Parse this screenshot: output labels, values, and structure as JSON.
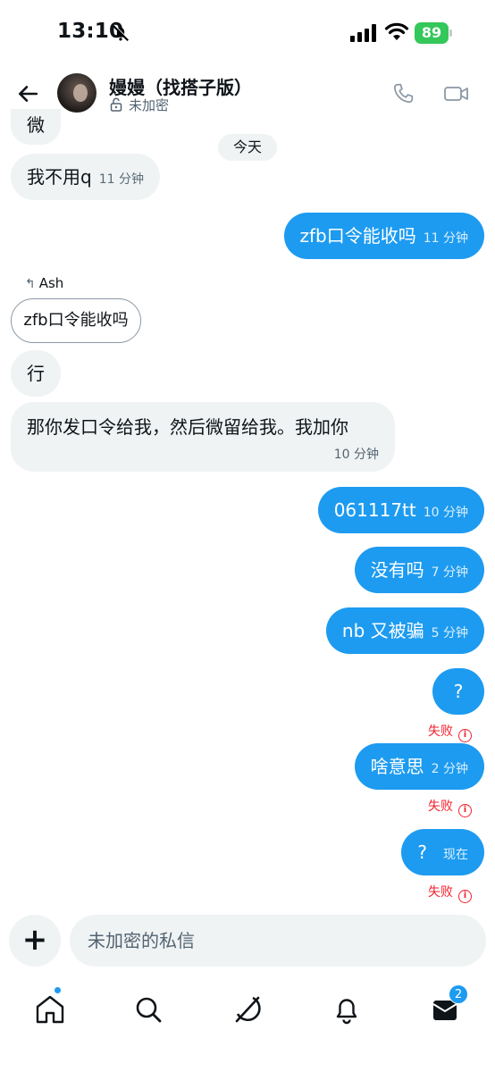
{
  "status_bar": {
    "time": "13:10",
    "battery": "89"
  },
  "header": {
    "name": "嫚嫚（找搭子版）",
    "encryption": "未加密"
  },
  "date_divider": "今天",
  "messages": [
    {
      "text": "微",
      "time": ""
    },
    {
      "text": "我不用q",
      "time": "11 分钟"
    },
    {
      "text": "zfb口令能收吗",
      "time": "11 分钟"
    },
    {
      "reply_to": "Ash",
      "quoted": "zfb口令能收吗"
    },
    {
      "text": "行",
      "time": ""
    },
    {
      "text": "那你发口令给我，然后微留给我。我加你",
      "time": "10 分钟"
    },
    {
      "text": "061117tt",
      "time": "10 分钟"
    },
    {
      "text": "没有吗",
      "time": "7 分钟"
    },
    {
      "text": "nb 又被骗",
      "time": "5 分钟"
    },
    {
      "text": "?",
      "time": "",
      "status": "失败"
    },
    {
      "text": "啥意思",
      "time": "2 分钟",
      "status": "失败"
    },
    {
      "text": "?",
      "time": "现在",
      "status": "失败"
    }
  ],
  "composer": {
    "placeholder": "未加密的私信",
    "plus": "+"
  },
  "nav": {
    "messages_badge": "2"
  },
  "colors": {
    "accent": "#1d9bf0",
    "received_bg": "#eff3f4",
    "error": "#f4212e"
  }
}
